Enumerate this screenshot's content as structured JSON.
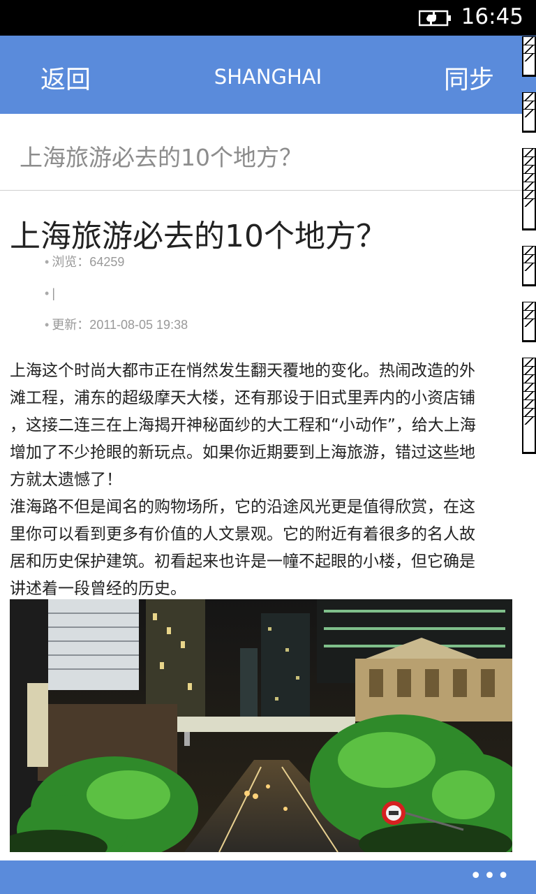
{
  "status_bar": {
    "battery_icon": "charging-battery-icon",
    "time": "16:45"
  },
  "header": {
    "back_label": "返回",
    "title": "SHANGHAI",
    "sync_label": "同步"
  },
  "subheader": {
    "title": "上海旅游必去的10个地方？"
  },
  "article": {
    "title": "上海旅游必去的10个地方？",
    "meta": [
      {
        "text": "浏览：64259"
      },
      {
        "text": "|"
      },
      {
        "text": "更新：2011-08-05 19:38"
      }
    ],
    "lines": [
      "上海这个时尚大都市正在悄然发生翻天覆地的变化。热闹改造的外",
      "滩工程，浦东的超级摩天大楼，还有那设于旧式里弄内的小资店铺",
      "，这接二连三在上海揭开神秘面纱的大工程和“小动作”，给大上海",
      "增加了不少抢眼的新玩点。如果你近期要到上海旅游，错过这些地",
      "方就太遗憾了！",
      "淮海路不但是闻名的购物场所，它的沿途风光更是值得欣赏，在这",
      "里你可以看到更多有价值的人文景观。它的附近有着很多的名人故",
      "居和历史保护建筑。初看起来也许是一幢不起眼的小楼，但它确是",
      "讲述着一段曾经的历史。"
    ],
    "image": {
      "subject": "Huaihai Road night street scene"
    }
  },
  "app_bar": {
    "more_label": "•••",
    "more_icon": "more-ellipsis-icon"
  }
}
